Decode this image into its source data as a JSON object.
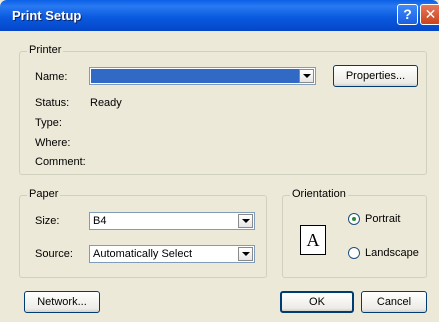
{
  "window": {
    "title": "Print Setup"
  },
  "printer_group": {
    "label": "Printer",
    "name_label": "Name:",
    "name_value": "",
    "properties_label": "Properties...",
    "status_label": "Status:",
    "status_value": "Ready",
    "type_label": "Type:",
    "where_label": "Where:",
    "comment_label": "Comment:"
  },
  "paper_group": {
    "label": "Paper",
    "size_label": "Size:",
    "size_value": "B4",
    "source_label": "Source:",
    "source_value": "Automatically Select"
  },
  "orientation_group": {
    "label": "Orientation",
    "icon_glyph": "A",
    "portrait_label": "Portrait",
    "landscape_label": "Landscape",
    "selected": "Portrait"
  },
  "footer": {
    "network_label": "Network...",
    "ok_label": "OK",
    "cancel_label": "Cancel"
  }
}
